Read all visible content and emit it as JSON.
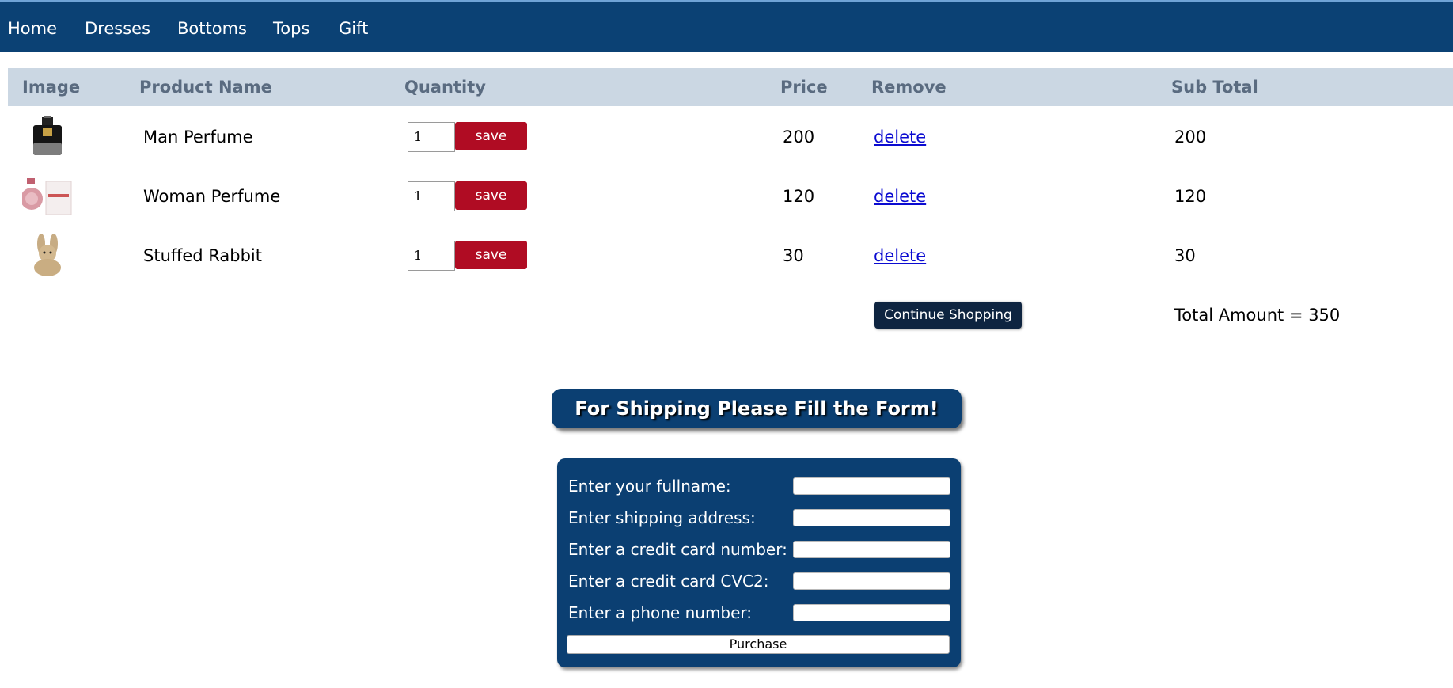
{
  "nav": {
    "items": [
      {
        "label": "Home"
      },
      {
        "label": "Dresses"
      },
      {
        "label": "Bottoms"
      },
      {
        "label": "Tops"
      },
      {
        "label": "Gift"
      }
    ]
  },
  "cart": {
    "headers": {
      "image": "Image",
      "product_name": "Product Name",
      "quantity": "Quantity",
      "price": "Price",
      "remove": "Remove",
      "subtotal": "Sub Total"
    },
    "rows": [
      {
        "name": "Man Perfume",
        "quantity": "1",
        "save_label": "save",
        "price": "200",
        "remove_label": "delete",
        "subtotal": "200",
        "image_icon": "perfume-bottle-icon"
      },
      {
        "name": "Woman Perfume",
        "quantity": "1",
        "save_label": "save",
        "price": "120",
        "remove_label": "delete",
        "subtotal": "120",
        "image_icon": "perfume-bottle-icon"
      },
      {
        "name": "Stuffed Rabbit",
        "quantity": "1",
        "save_label": "save",
        "price": "30",
        "remove_label": "delete",
        "subtotal": "30",
        "image_icon": "rabbit-plush-icon"
      }
    ],
    "continue_label": "Continue Shopping",
    "total_text": "Total Amount = 350"
  },
  "shipping": {
    "banner": "For Shipping Please Fill the Form!",
    "fields": [
      {
        "label": "Enter your fullname:",
        "value": ""
      },
      {
        "label": "Enter shipping address:",
        "value": ""
      },
      {
        "label": "Enter a credit card number:",
        "value": ""
      },
      {
        "label": "Enter a credit card CVC2:",
        "value": ""
      },
      {
        "label": "Enter a phone number:",
        "value": ""
      }
    ],
    "purchase_label": "Purchase"
  },
  "colors": {
    "nav_bg": "#0b4174",
    "table_header_bg": "#cbd7e3",
    "save_button": "#b00c23",
    "link": "#0b0bd1",
    "continue_button": "#0e2440",
    "form_bg": "#0b3f72"
  }
}
